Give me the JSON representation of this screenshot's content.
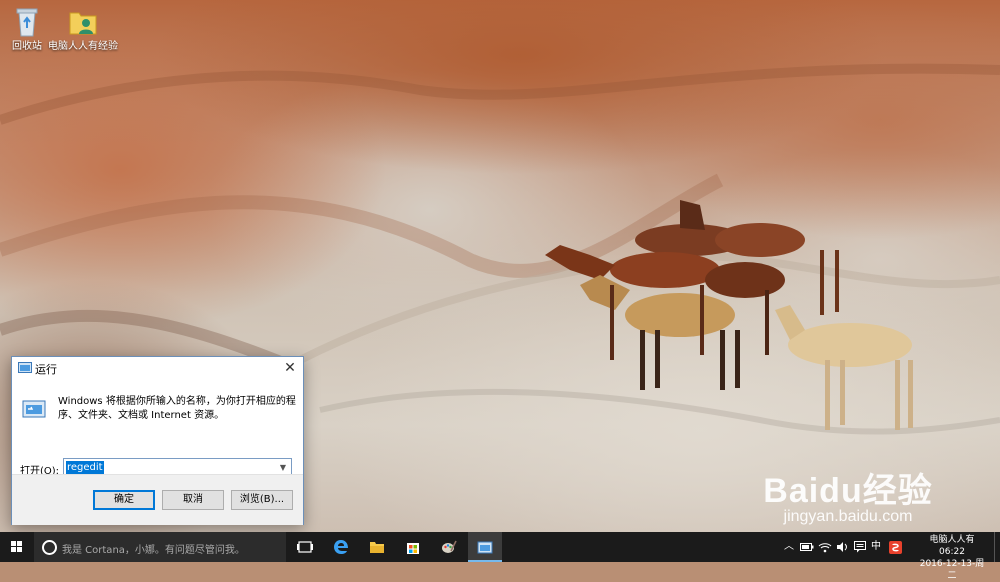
{
  "desktop": {
    "icons": [
      {
        "label": "回收站"
      },
      {
        "label": "电脑人人有经验"
      }
    ],
    "watermark": {
      "logo": "Baidu经验",
      "site": "jingyan.baidu.com"
    }
  },
  "run_dialog": {
    "title": "运行",
    "description": "Windows 将根据你所输入的名称，为你打开相应的程序、文件夹、文档或 Internet 资源。",
    "open_label": "打开(O):",
    "input_value": "regedit",
    "buttons": {
      "ok": "确定",
      "cancel": "取消",
      "browse": "浏览(B)..."
    }
  },
  "taskbar": {
    "search_placeholder": "我是 Cortana，小娜。有问题尽管问我。",
    "tray": {
      "ime": "中"
    },
    "clock": {
      "line1": "电脑人人有 06:22",
      "line2": "2016-12-13-周二"
    }
  },
  "colors": {
    "accent": "#0078d7",
    "taskbar": "#1b1b1b"
  }
}
